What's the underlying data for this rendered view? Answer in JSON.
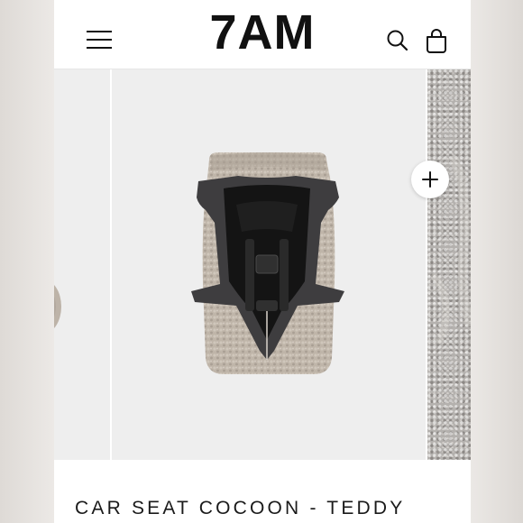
{
  "header": {
    "brand": "7AM",
    "icons": [
      "menu-icon",
      "search-icon",
      "cart-icon"
    ]
  },
  "gallery": {
    "zoom_icon": "plus-icon"
  },
  "product": {
    "title": "CAR SEAT COCOON - TEDDY"
  },
  "colors": {
    "text": "#111111",
    "gallery_bg": "#eeeeee",
    "teddy": "#c0b6aa",
    "liner": "#3e3d3f"
  }
}
